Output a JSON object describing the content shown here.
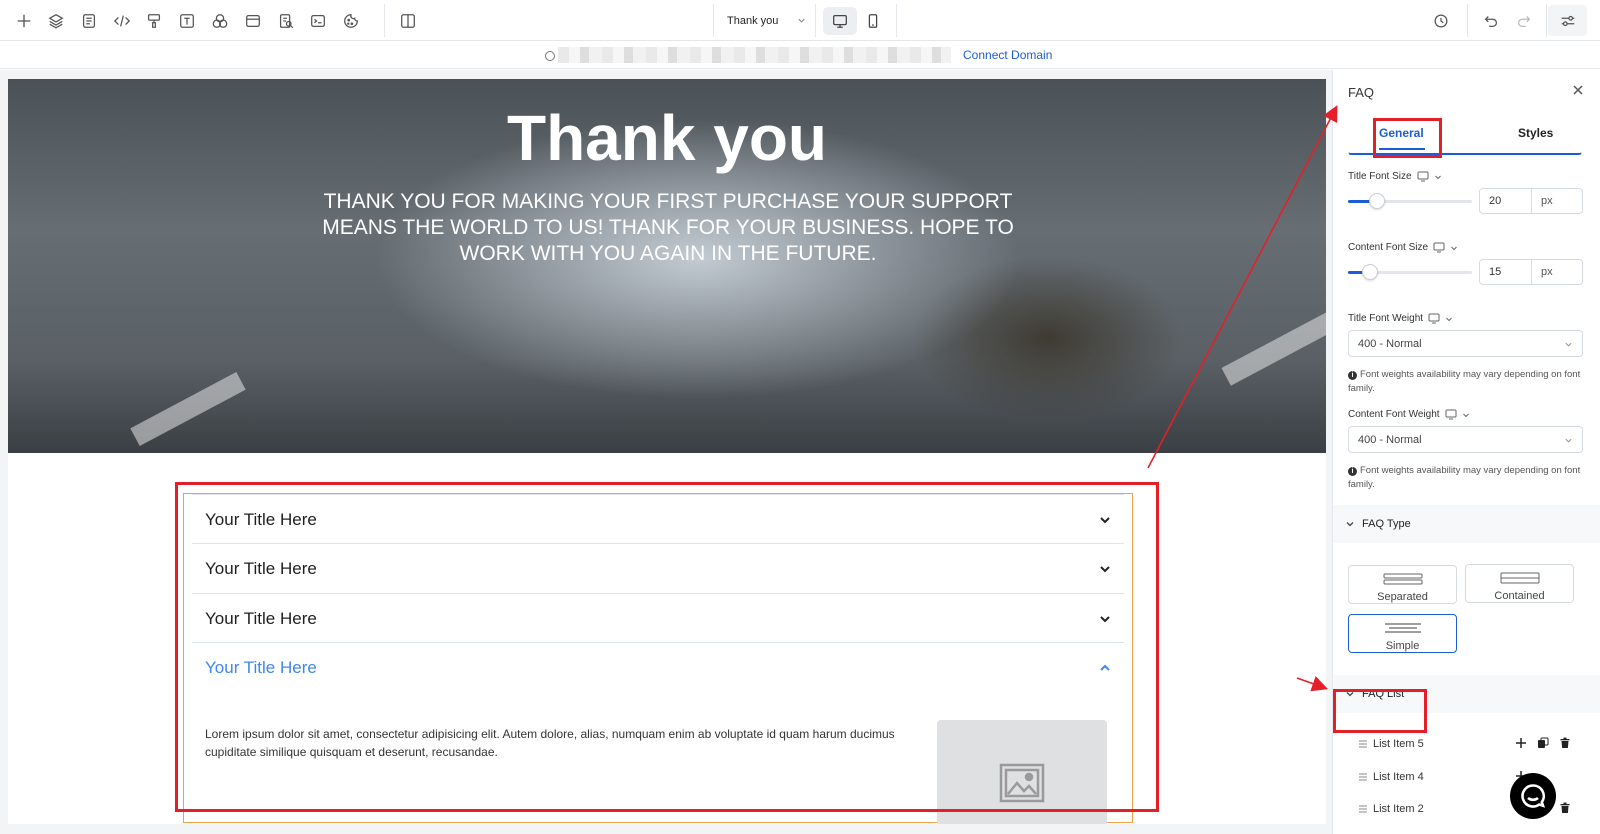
{
  "toolbar": {
    "page_name": "Thank you",
    "left_icons": [
      "add-icon",
      "layers-icon",
      "pages-icon",
      "code-icon",
      "paint-icon",
      "text-icon",
      "shapes-icon",
      "browser-icon",
      "seo-icon",
      "terminal-icon",
      "cookie-icon",
      "sidebar-toggle-icon"
    ],
    "devices": [
      "desktop",
      "mobile"
    ],
    "active_device": "desktop",
    "right_icons": [
      "history-icon",
      "undo-icon",
      "redo-icon",
      "settings-sliders-icon"
    ]
  },
  "urlbar": {
    "connect_label": "Connect Domain",
    "accent": "#1d5cd8"
  },
  "hero": {
    "title": "Thank you",
    "subtitle": "THANK YOU FOR MAKING YOUR FIRST PURCHASE YOUR SUPPORT MEANS THE WORLD TO US! THANK FOR YOUR BUSINESS. HOPE TO WORK WITH YOU AGAIN IN THE FUTURE."
  },
  "faq": {
    "items": [
      {
        "title": "Your Title Here",
        "open": false
      },
      {
        "title": "Your Title Here",
        "open": false
      },
      {
        "title": "Your Title Here",
        "open": false
      },
      {
        "title": "Your Title Here",
        "open": true
      }
    ],
    "content": "Lorem ipsum dolor sit amet, consectetur adipisicing elit. Autem dolore, alias, numquam enim ab voluptate id quam harum ducimus cupiditate similique quisquam et deserunt, recusandae.",
    "open_color": "#3f86ee"
  },
  "panel": {
    "title": "FAQ",
    "tabs": [
      "General",
      "Styles"
    ],
    "active_tab": "General",
    "title_font_size": {
      "label": "Title Font Size",
      "value": "20",
      "unit": "px",
      "slider_fraction": 0.23
    },
    "content_font_size": {
      "label": "Content Font Size",
      "value": "15",
      "unit": "px",
      "slider_fraction": 0.18
    },
    "title_font_weight": {
      "label": "Title Font Weight",
      "value": "400 - Normal"
    },
    "content_font_weight": {
      "label": "Content Font Weight",
      "value": "400 - Normal"
    },
    "weight_note": "Font weights availability may vary depending on font family.",
    "faq_type": {
      "label": "FAQ Type",
      "options": [
        "Separated",
        "Contained",
        "Simple"
      ],
      "selected": "Simple"
    },
    "faq_list": {
      "label": "FAQ List",
      "items": [
        "List Item 5",
        "List Item 4",
        "List Item 2"
      ]
    }
  },
  "annotation_color": "#e3202a"
}
